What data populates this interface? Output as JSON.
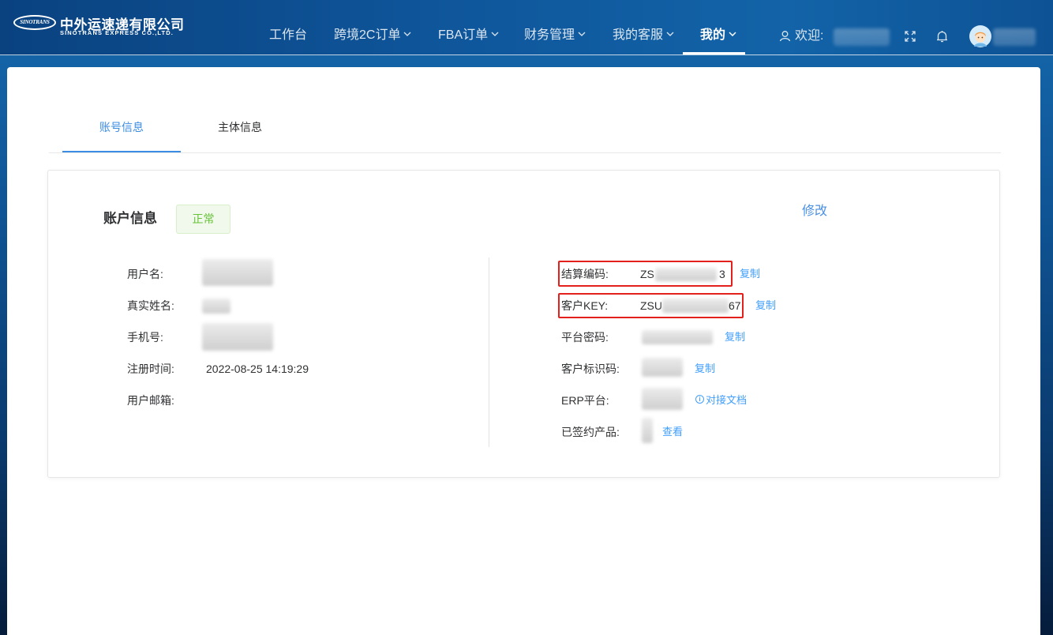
{
  "header": {
    "logo": {
      "emblem_text": "SINOTRANS",
      "name_cn": "中外运速递有限公司",
      "name_en": "SINOTRANS EXPRESS CO.,LTD."
    },
    "nav": [
      {
        "label": "工作台",
        "dropdown": false,
        "active": false
      },
      {
        "label": "跨境2C订单",
        "dropdown": true,
        "active": false
      },
      {
        "label": "FBA订单",
        "dropdown": true,
        "active": false
      },
      {
        "label": "财务管理",
        "dropdown": true,
        "active": false
      },
      {
        "label": "我的客服",
        "dropdown": true,
        "active": false
      },
      {
        "label": "我的",
        "dropdown": true,
        "active": true
      }
    ],
    "welcome_label": "欢迎:",
    "icons": {
      "user": "user-icon",
      "fullscreen": "fullscreen-icon",
      "notifications": "bell-icon",
      "dropdown": "chevron-down-icon",
      "avatar": "avatar"
    }
  },
  "tabs": [
    {
      "label": "账号信息",
      "active": true
    },
    {
      "label": "主体信息",
      "active": false
    }
  ],
  "account": {
    "title": "账户信息",
    "status": "正常",
    "edit_label": "修改",
    "left_fields": [
      {
        "label": "用户名:"
      },
      {
        "label": "真实姓名:"
      },
      {
        "label": "手机号:"
      },
      {
        "label": "注册时间:",
        "value": "2022-08-25 14:19:29"
      },
      {
        "label": "用户邮箱:"
      }
    ],
    "right_fields": [
      {
        "label": "结算编码:",
        "value_prefix": "ZS",
        "value_suffix": "3",
        "action": "复制"
      },
      {
        "label": "客户KEY:",
        "value_prefix": "ZSU",
        "value_suffix": "67",
        "action": "复制"
      },
      {
        "label": "平台密码:",
        "action": "复制"
      },
      {
        "label": "客户标识码:",
        "action": "复制"
      },
      {
        "label": "ERP平台:",
        "action": "对接文档",
        "action_icon": "info-icon"
      },
      {
        "label": "已签约产品:",
        "action": "查看"
      }
    ]
  },
  "colors": {
    "accent": "#409eff",
    "tab_active": "#3b8ce3",
    "status_text": "#67c23a",
    "status_bg": "#f0f9eb",
    "highlight_box": "#e3201b"
  }
}
